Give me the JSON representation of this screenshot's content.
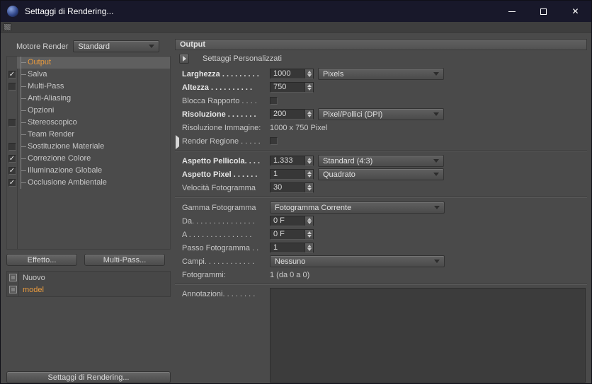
{
  "glyphs": {
    "check": "✓",
    "close": "✕"
  },
  "colors": {
    "accent_orange": "#ea9b3e",
    "background": "#4a4a4a",
    "titlebar": "#18182a"
  },
  "window": {
    "title": "Settaggi di Rendering..."
  },
  "sidebar": {
    "engine_label": "Motore Render",
    "engine_value": "Standard",
    "items": [
      {
        "label": "Output",
        "selected": true
      },
      {
        "label": "Salva",
        "checkbox": true,
        "checked": true
      },
      {
        "label": "Multi-Pass",
        "checkbox": true,
        "checked": false
      },
      {
        "label": "Anti-Aliasing"
      },
      {
        "label": "Opzioni"
      },
      {
        "label": "Stereoscopico",
        "checkbox": true,
        "checked": false
      },
      {
        "label": "Team Render"
      },
      {
        "label": "Sostituzione Materiale",
        "checkbox": true,
        "checked": false
      },
      {
        "label": "Correzione Colore",
        "checkbox": true,
        "checked": true
      },
      {
        "label": "Illuminazione Globale",
        "checkbox": true,
        "checked": true
      },
      {
        "label": "Occlusione Ambientale",
        "checkbox": true,
        "checked": true
      }
    ],
    "effect_button": "Effetto...",
    "multipass_button": "Multi-Pass...",
    "presets": [
      {
        "label": "Nuovo",
        "selected": false
      },
      {
        "label": "model",
        "selected": true
      }
    ],
    "render_settings_button": "Settaggi di Rendering..."
  },
  "main": {
    "header": "Output",
    "custom_settings_label": "Settaggi  Personalizzati",
    "rows": [
      {
        "type": "number",
        "name": "width",
        "label": "Larghezza . . . . . . . . .",
        "bold": true,
        "value": "1000",
        "dropdown": "Pixels"
      },
      {
        "type": "number",
        "name": "height",
        "label": "Altezza . . . . . . . . . .",
        "bold": true,
        "value": "750"
      },
      {
        "type": "checkbox",
        "name": "lock-ratio",
        "label": "Blocca Rapporto . . . .",
        "checked": false
      },
      {
        "type": "number",
        "name": "resolution",
        "label": "Risoluzione . . . . . . .",
        "bold": true,
        "value": "200",
        "dropdown": "Pixel/Pollici (DPI)"
      },
      {
        "type": "static",
        "name": "image-resolution",
        "label": "Risoluzione Immagine:",
        "value": "1000 x 750 Pixel"
      },
      {
        "type": "checkbox",
        "name": "render-region",
        "label": "Render Regione . . . . .",
        "checked": false,
        "expander": true
      },
      {
        "type": "separator"
      },
      {
        "type": "number",
        "name": "film-aspect",
        "label": "Aspetto Pellicola. . . .",
        "bold": true,
        "value": "1.333",
        "dropdown": "Standard (4:3)"
      },
      {
        "type": "number",
        "name": "pixel-aspect",
        "label": "Aspetto Pixel . . . . . .",
        "bold": true,
        "value": "1",
        "dropdown": "Quadrato"
      },
      {
        "type": "number",
        "name": "frame-rate",
        "label": "Velocità Fotogramma",
        "value": "30"
      },
      {
        "type": "separator"
      },
      {
        "type": "dropdown",
        "name": "frame-range",
        "label": "Gamma Fotogramma",
        "value": "Fotogramma Corrente"
      },
      {
        "type": "number",
        "name": "from-frame",
        "label": "Da. . . . . . . . . . . . . . .",
        "value": "0 F"
      },
      {
        "type": "number",
        "name": "to-frame",
        "label": "A . . . . . . . . . . . . . . .",
        "value": "0 F"
      },
      {
        "type": "number",
        "name": "frame-step",
        "label": "Passo Fotogramma . .",
        "value": "1"
      },
      {
        "type": "dropdown",
        "name": "fields",
        "label": "Campi. . . . . . . . . . . .",
        "value": "Nessuno"
      },
      {
        "type": "static",
        "name": "frames",
        "label": "Fotogrammi:",
        "value": "1 (da 0 a 0)"
      },
      {
        "type": "separator"
      },
      {
        "type": "textarea",
        "name": "annotations",
        "label": "Annotazioni. . . . . . . .",
        "value": ""
      }
    ]
  }
}
